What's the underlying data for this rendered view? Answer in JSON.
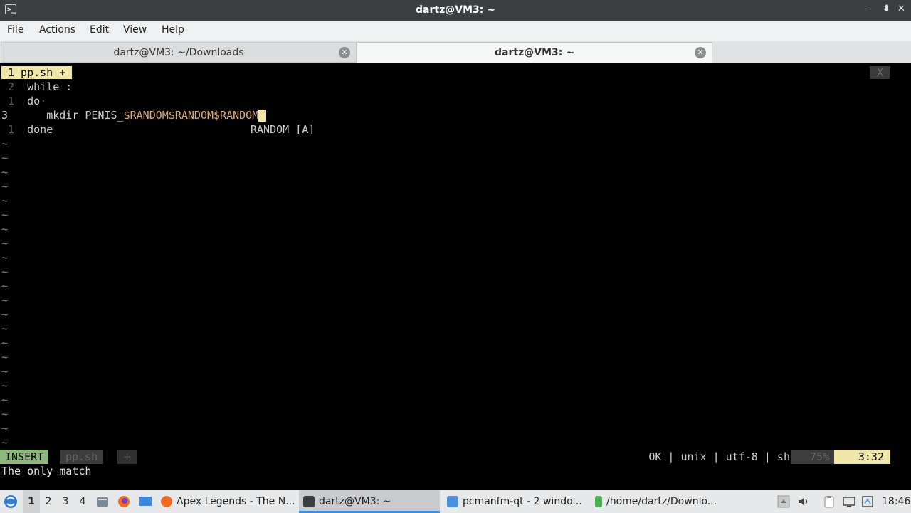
{
  "window": {
    "title": "dartz@VM3: ~",
    "icon_glyph": ">_",
    "min_glyph": "–",
    "max_glyph": "⬍",
    "close_glyph": "✕"
  },
  "menu": [
    "File",
    "Actions",
    "Edit",
    "View",
    "Help"
  ],
  "tabs": [
    {
      "label": "dartz@VM3: ~/Downloads",
      "active": false
    },
    {
      "label": "dartz@VM3: ~",
      "active": true
    }
  ],
  "tab_close_glyph": "✕",
  "vim": {
    "buffer_label": "1  pp.sh  +",
    "close_label": "X",
    "lines": [
      {
        "num": " 2",
        "text": "while :"
      },
      {
        "num": " 1",
        "text": "do",
        "trail": "·"
      },
      {
        "num": "3  ",
        "text": "    mkdir PENIS_",
        "var_text": "$RANDOM$RANDOM$RANDOM"
      },
      {
        "num": " 1",
        "text": "done",
        "completion": "RANDOM [A]"
      }
    ],
    "tilde": "~",
    "mode": "INSERT",
    "file": "pp.sh",
    "modified": "+",
    "status_info": "OK | unix | utf-8 | sh",
    "percent": "75%",
    "position": "3:32",
    "message": "The only match"
  },
  "taskbar": {
    "workspaces": [
      "1",
      "2",
      "3",
      "4"
    ],
    "tasks": [
      {
        "label": "Apex Legends - The N...",
        "icon": "firefox-icon"
      },
      {
        "label": "dartz@VM3: ~",
        "icon": "terminal-icon"
      },
      {
        "label": "pcmanfm-qt - 2 windo...",
        "icon": "folder-icon"
      },
      {
        "label": "/home/dartz/Downlo...",
        "icon": "file-manager-icon"
      }
    ],
    "clock": "18:46"
  },
  "colors": {
    "accent_yellow": "#f0e6a8",
    "insert_green": "#8cb87a",
    "var_orange": "#dcae84",
    "taskbar_blue": "#3d8ee0"
  }
}
